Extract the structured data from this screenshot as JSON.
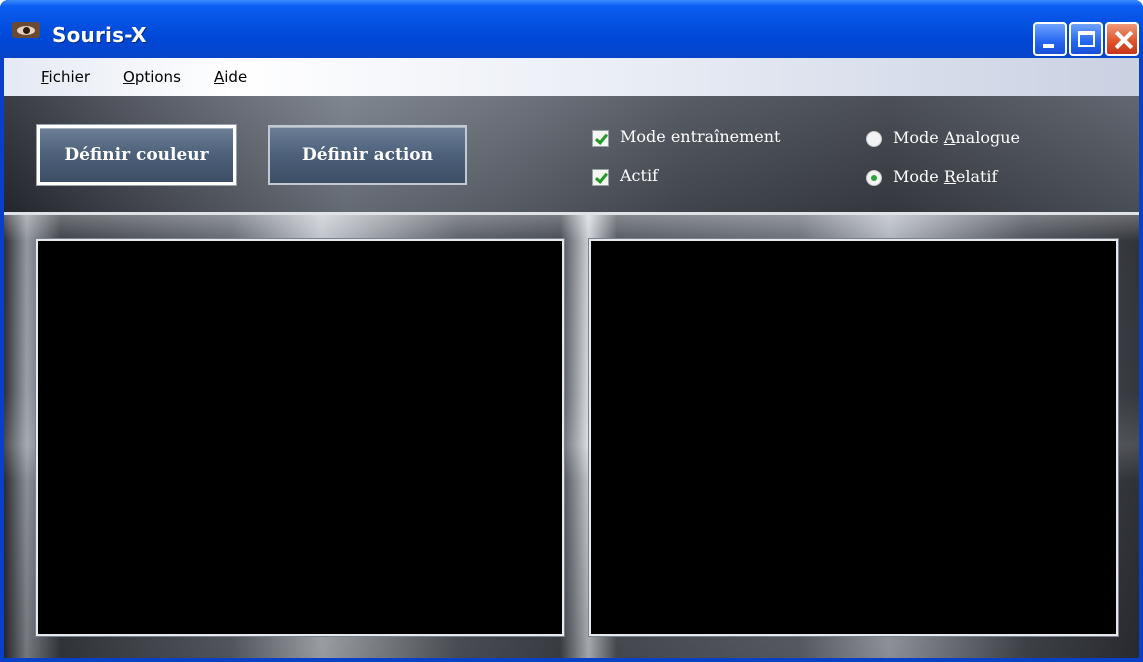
{
  "window": {
    "title": "Souris-X",
    "app_icon": "eye-icon",
    "controls": [
      "minimize-icon",
      "maximize-icon",
      "close-icon"
    ]
  },
  "menu": {
    "fichier": {
      "accel": "F",
      "rest": "ichier"
    },
    "options": {
      "accel": "O",
      "rest": "ptions"
    },
    "aide": {
      "accel": "A",
      "rest": "ide"
    }
  },
  "toolbar": {
    "define_color_label": "Définir couleur",
    "define_action_label": "Définir action",
    "training_mode": {
      "label": "Mode entraînement",
      "checked": true
    },
    "active": {
      "label": "Actif",
      "checked": true
    },
    "analog_mode": {
      "before": "Mode ",
      "accel": "A",
      "after": "nalogue",
      "selected": false
    },
    "relative_mode": {
      "before": "Mode ",
      "accel": "R",
      "after": "elatif",
      "selected": true
    }
  },
  "colors": {
    "title_bar": "#0a5ef2",
    "close_button": "#e0572e",
    "check_mark": "#1f9a2a",
    "video_bg": "#000000"
  }
}
